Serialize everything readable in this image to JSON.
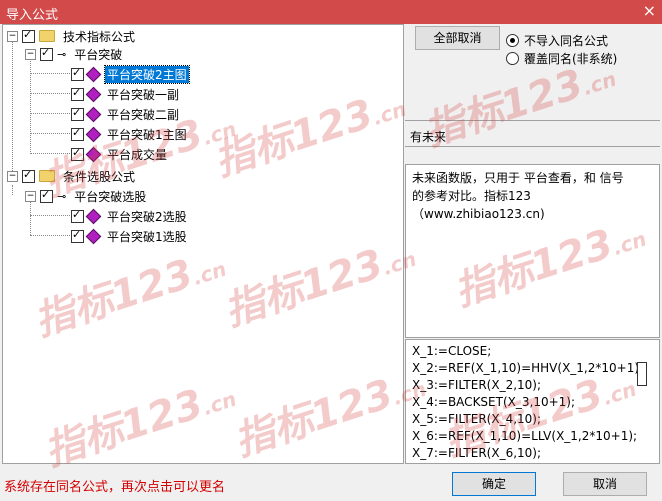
{
  "window": {
    "title": "导入公式",
    "close_glyph": "×"
  },
  "tree": {
    "root1": {
      "label": "技术指标公式"
    },
    "group1": {
      "label": "平台突破"
    },
    "group1_items": [
      {
        "label": "平台突破2主图",
        "selected": true
      },
      {
        "label": "平台突破一副"
      },
      {
        "label": "平台突破二副"
      },
      {
        "label": "平台突破1主图"
      },
      {
        "label": "平台成交量"
      }
    ],
    "root2": {
      "label": "条件选股公式"
    },
    "group2": {
      "label": "平台突破选股"
    },
    "group2_items": [
      {
        "label": "平台突破2选股"
      },
      {
        "label": "平台突破1选股"
      }
    ]
  },
  "buttons": {
    "cancel_all": "全部取消",
    "ok": "确定",
    "cancel": "取消"
  },
  "options": {
    "no_import": "不导入同名公式",
    "overwrite": "覆盖同名(非系统)"
  },
  "future_label": "有未来",
  "description": [
    "未来函数版，只用于 平台查看，和 信号",
    "的参考对比。指标123",
    "（www.zhibiao123.cn)"
  ],
  "formula": [
    "X_1:=CLOSE;",
    "X_2:=REF(X_1,10)=HHV(X_1,2*10+1);",
    "X_3:=FILTER(X_2,10);",
    "X_4:=BACKSET(X_3,10+1);",
    "X_5:=FILTER(X_4,10);",
    "X_6:=REF(X_1,10)=LLV(X_1,2*10+1);",
    "X_7:=FILTER(X_6,10);"
  ],
  "status_message": "系统存在同名公式，再次点击可以更名",
  "watermark": {
    "text": "指标123",
    "suffix": ".cn"
  },
  "colors": {
    "title_bar": "#d24a4a",
    "selection": "#0078d7",
    "status_text": "#d40000"
  }
}
